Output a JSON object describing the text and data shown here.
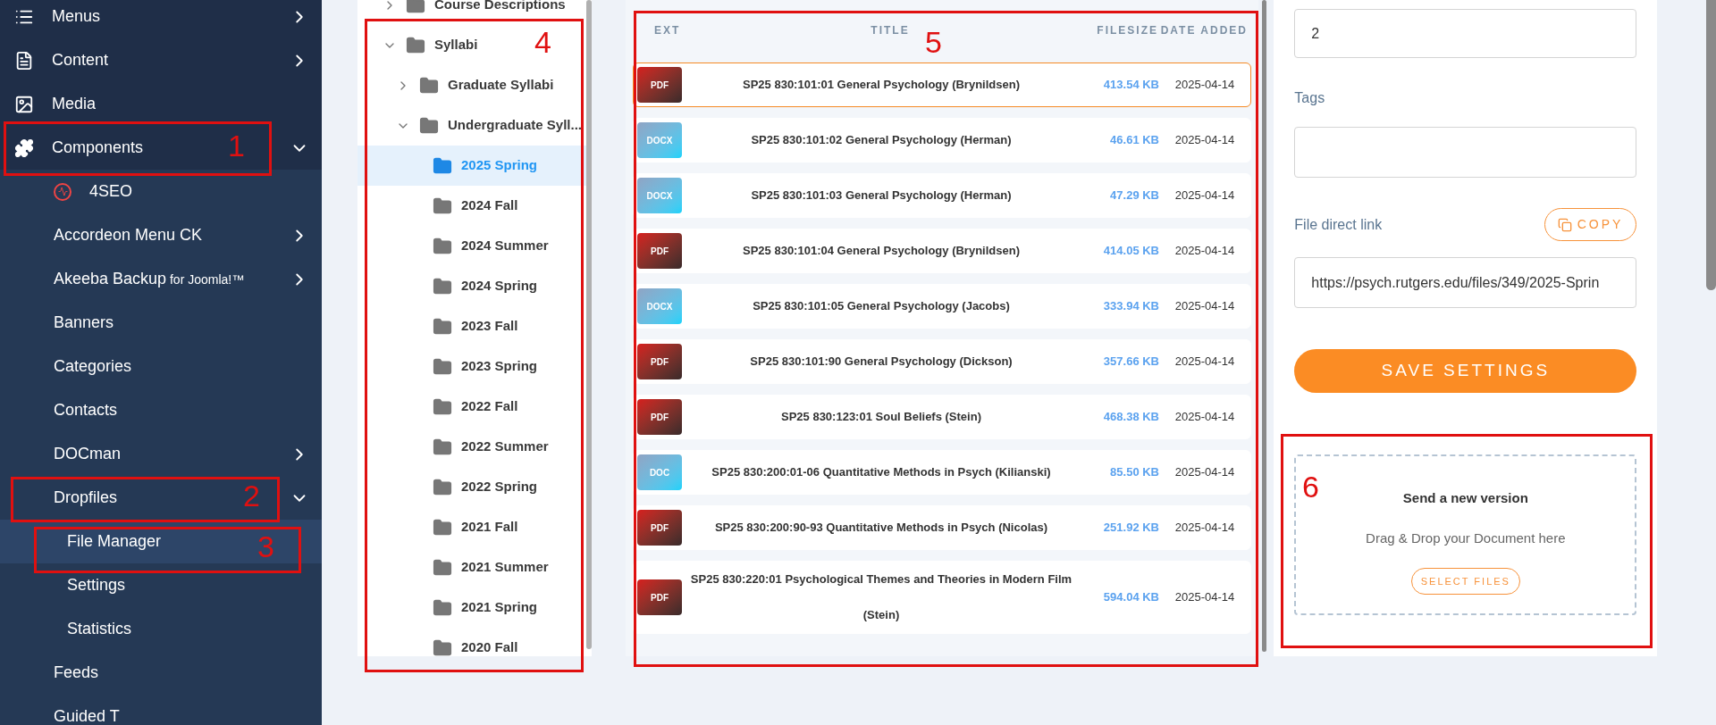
{
  "sidebar": {
    "items": [
      {
        "label": "Menus",
        "expanded": false,
        "selected": false
      },
      {
        "label": "Content",
        "expanded": false,
        "selected": false
      },
      {
        "label": "Media",
        "selected": false
      },
      {
        "label": "Components",
        "expanded": true,
        "selected": false,
        "children": [
          {
            "label": "4SEO",
            "selected": false
          },
          {
            "label": "Accordeon Menu CK",
            "expanded": false,
            "selected": false
          },
          {
            "label": "Akeeba Backup",
            "suffix": "for Joomla!™",
            "expanded": false,
            "selected": false
          },
          {
            "label": "Banners",
            "selected": false
          },
          {
            "label": "Categories",
            "selected": false
          },
          {
            "label": "Contacts",
            "selected": false
          },
          {
            "label": "DOCman",
            "expanded": false,
            "selected": false
          },
          {
            "label": "Dropfiles",
            "expanded": true,
            "selected": false,
            "children": [
              {
                "label": "File Manager",
                "selected": true
              },
              {
                "label": "Settings",
                "selected": false
              },
              {
                "label": "Statistics",
                "selected": false
              }
            ]
          },
          {
            "label": "Feeds",
            "selected": false
          },
          {
            "label": "Guided T",
            "selected": false
          }
        ]
      }
    ]
  },
  "tree": [
    {
      "label": "Course Descriptions",
      "expanded": false,
      "selected": false
    },
    {
      "label": "Syllabi",
      "expanded": true,
      "selected": false,
      "children": [
        {
          "label": "Graduate Syllabi",
          "expanded": false,
          "selected": false
        },
        {
          "label": "Undergraduate Syll...",
          "expanded": true,
          "selected": false,
          "children": [
            {
              "label": "2025 Spring",
              "selected": true
            },
            {
              "label": "2024 Fall",
              "selected": false
            },
            {
              "label": "2024 Summer",
              "selected": false
            },
            {
              "label": "2024 Spring",
              "selected": false
            },
            {
              "label": "2023 Fall",
              "selected": false
            },
            {
              "label": "2023 Spring",
              "selected": false
            },
            {
              "label": "2022 Fall",
              "selected": false
            },
            {
              "label": "2022 Summer",
              "selected": false
            },
            {
              "label": "2022 Spring",
              "selected": false
            },
            {
              "label": "2021 Fall",
              "selected": false
            },
            {
              "label": "2021 Summer",
              "selected": false
            },
            {
              "label": "2021 Spring",
              "selected": false
            },
            {
              "label": "2020 Fall",
              "selected": false
            }
          ]
        }
      ]
    }
  ],
  "table": {
    "columns": [
      "EXT",
      "TITLE",
      "FILESIZE",
      "DATE ADDED"
    ],
    "rows": [
      {
        "ext": "PDF",
        "kind": "pdf",
        "title": "SP25 830:101:01 General Psychology (Brynildsen)",
        "filesize": "413.54 KB",
        "date": "2025-04-14",
        "selected": true
      },
      {
        "ext": "DOCX",
        "kind": "word",
        "title": "SP25 830:101:02 General Psychology (Herman)",
        "filesize": "46.61 KB",
        "date": "2025-04-14",
        "selected": false
      },
      {
        "ext": "DOCX",
        "kind": "word",
        "title": "SP25 830:101:03 General Psychology (Herman)",
        "filesize": "47.29 KB",
        "date": "2025-04-14",
        "selected": false
      },
      {
        "ext": "PDF",
        "kind": "pdf",
        "title": "SP25 830:101:04 General Psychology (Brynildsen)",
        "filesize": "414.05 KB",
        "date": "2025-04-14",
        "selected": false
      },
      {
        "ext": "DOCX",
        "kind": "word",
        "title": "SP25 830:101:05 General Psychology (Jacobs)",
        "filesize": "333.94 KB",
        "date": "2025-04-14",
        "selected": false
      },
      {
        "ext": "PDF",
        "kind": "pdf",
        "title": "SP25 830:101:90 General Psychology (Dickson)",
        "filesize": "357.66 KB",
        "date": "2025-04-14",
        "selected": false
      },
      {
        "ext": "PDF",
        "kind": "pdf",
        "title": "SP25 830:123:01 Soul Beliefs (Stein)",
        "filesize": "468.38 KB",
        "date": "2025-04-14",
        "selected": false
      },
      {
        "ext": "DOC",
        "kind": "word",
        "title": "SP25 830:200:01-06 Quantitative Methods in Psych (Kilianski)",
        "filesize": "85.50 KB",
        "date": "2025-04-14",
        "selected": false
      },
      {
        "ext": "PDF",
        "kind": "pdf",
        "title": "SP25 830:200:90-93 Quantitative Methods in Psych (Nicolas)",
        "filesize": "251.92 KB",
        "date": "2025-04-14",
        "selected": false
      },
      {
        "ext": "PDF",
        "kind": "pdf",
        "title": "SP25 830:220:01 Psychological Themes and Theories in Modern Film (Stein)",
        "filesize": "594.04 KB",
        "date": "2025-04-14",
        "selected": false
      }
    ]
  },
  "settings": {
    "field_value": "2",
    "tags_label": "Tags",
    "link_label": "File direct link",
    "copy_button": "COPY",
    "link_value": "https://psych.rutgers.edu/files/349/2025-Sprin",
    "save_button": "SAVE SETTINGS"
  },
  "upload": {
    "title": "Send a new version",
    "text": "Drag & Drop your Document here",
    "button": "SELECT FILES"
  },
  "annotations": [
    "1",
    "2",
    "3",
    "4",
    "5",
    "6"
  ]
}
